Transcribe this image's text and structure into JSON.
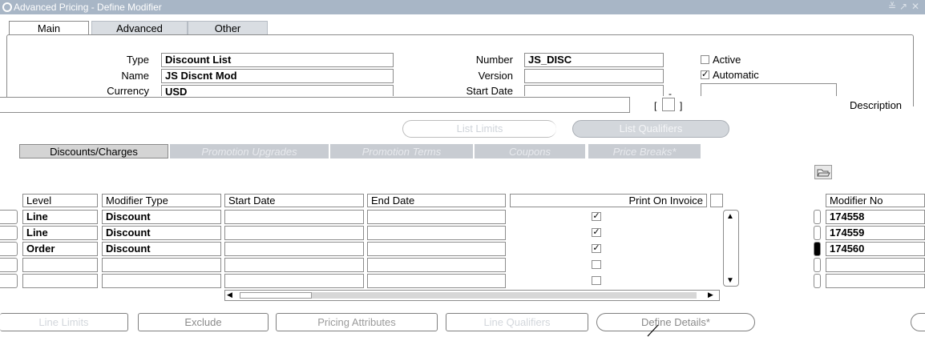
{
  "window": {
    "title": "Advanced Pricing - Define Modifier",
    "controls": [
      "≚",
      "↗",
      "✕"
    ]
  },
  "tabs": [
    {
      "label": "Main",
      "active": true
    },
    {
      "label": "Advanced",
      "active": false
    },
    {
      "label": "Other",
      "active": false
    }
  ],
  "header_form": {
    "type_label": "Type",
    "type_value": "Discount List",
    "name_label": "Name",
    "name_value": "JS Discnt Mod",
    "currency_label": "Currency",
    "currency_value": "USD",
    "number_label": "Number",
    "number_value": "JS_DISC",
    "version_label": "Version",
    "version_value": "",
    "start_date_label": "Start Date",
    "start_date_value": "",
    "active_label": "Active",
    "active_checked": false,
    "automatic_label": "Automatic",
    "automatic_checked": true,
    "description_label": "Description",
    "description_value": ""
  },
  "list_buttons": {
    "list_limits": "List Limits",
    "list_qualifiers": "List Qualifiers"
  },
  "subtabs": [
    {
      "label": "Discounts/Charges",
      "active": true
    },
    {
      "label": "Promotion Upgrades",
      "active": false
    },
    {
      "label": "Promotion Terms",
      "active": false
    },
    {
      "label": "Coupons",
      "active": false
    },
    {
      "label": "Price Breaks*",
      "active": false
    }
  ],
  "lines_table": {
    "columns": [
      "Level",
      "Modifier Type",
      "Start Date",
      "End Date",
      "Print On Invoice"
    ],
    "modifier_no_header": "Modifier No",
    "rows": [
      {
        "level": "Line",
        "modifier_type": "Discount",
        "start_date": "",
        "end_date": "",
        "print_on_invoice": true,
        "modifier_no": "174558"
      },
      {
        "level": "Line",
        "modifier_type": "Discount",
        "start_date": "",
        "end_date": "",
        "print_on_invoice": true,
        "modifier_no": "174559"
      },
      {
        "level": "Order",
        "modifier_type": "Discount",
        "start_date": "",
        "end_date": "",
        "print_on_invoice": true,
        "modifier_no": "174560"
      },
      {
        "level": "",
        "modifier_type": "",
        "start_date": "",
        "end_date": "",
        "print_on_invoice": false,
        "modifier_no": ""
      },
      {
        "level": "",
        "modifier_type": "",
        "start_date": "",
        "end_date": "",
        "print_on_invoice": false,
        "modifier_no": ""
      }
    ]
  },
  "bottom_buttons": {
    "line_limits": "Line Limits",
    "exclude": "Exclude",
    "pricing_attributes": "Pricing Attributes",
    "line_qualifiers": "Line Qualifiers",
    "define_details": "Define Details*"
  },
  "colors": {
    "titlebar": "#a8b6c6",
    "disabled_text": "#cfd4da",
    "selected_tab": "#d4d4d4"
  }
}
